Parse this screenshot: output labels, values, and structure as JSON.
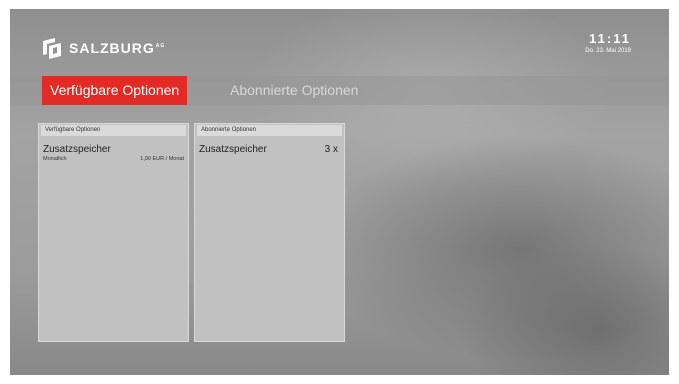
{
  "brand": {
    "name": "SALZBURG",
    "suffix": "AG"
  },
  "clock": {
    "time": "11:11",
    "date": "Do. 23. Mai 2019"
  },
  "tabs": [
    {
      "label": "Verfügbare Optionen",
      "active": true
    },
    {
      "label": "Abonnierte Optionen",
      "active": false
    }
  ],
  "available_panel": {
    "header": "Verfügbare Optionen",
    "items": [
      {
        "title": "Zusatzspeicher",
        "sub_label": "Monatlich",
        "price": "1,90 EUR / Monat"
      }
    ]
  },
  "subscribed_panel": {
    "header": "Abonnierte Optionen",
    "items": [
      {
        "title": "Zusatzspeicher",
        "count": "3 x"
      }
    ]
  },
  "colors": {
    "accent": "#e42a24",
    "panel": "#c1c1c1"
  }
}
